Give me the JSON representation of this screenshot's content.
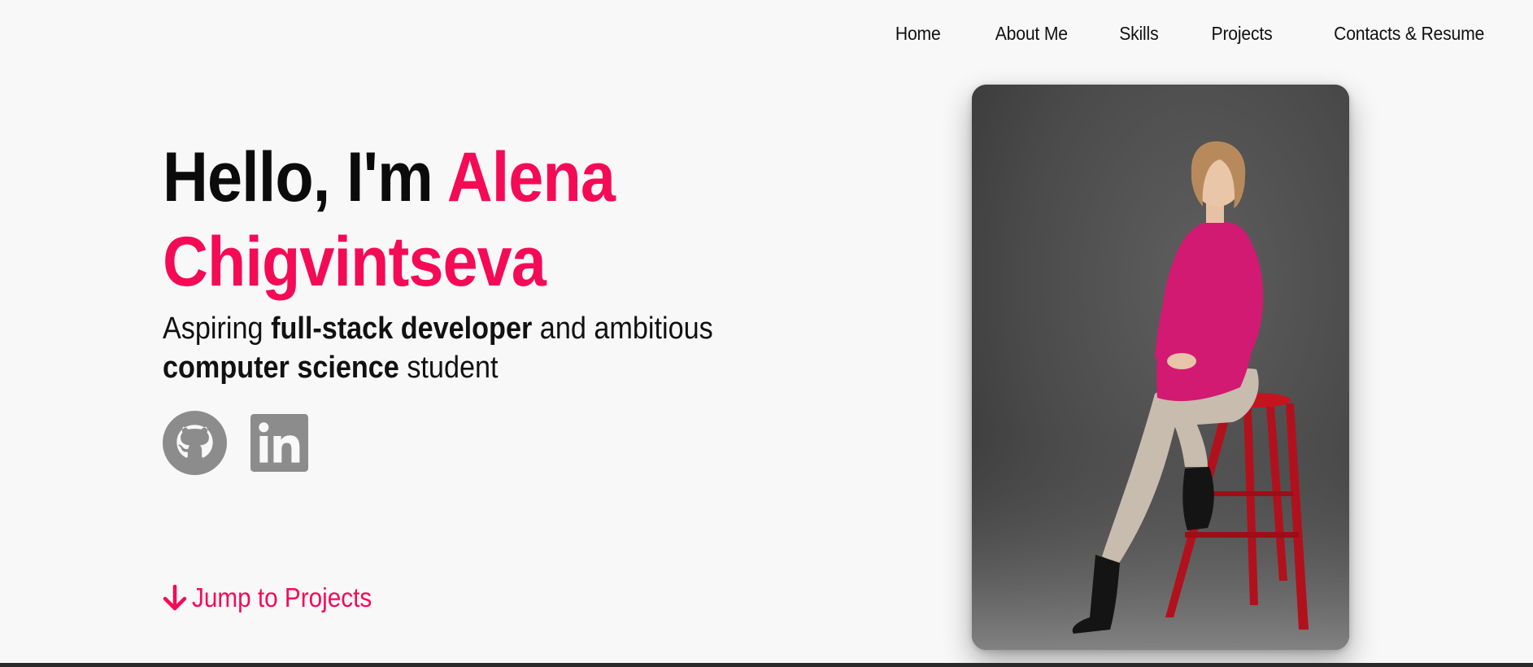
{
  "nav": {
    "items": [
      {
        "label": "Home"
      },
      {
        "label": "About Me"
      },
      {
        "label": "Skills"
      },
      {
        "label": "Projects"
      },
      {
        "label": "Contacts & Resume"
      }
    ]
  },
  "hero": {
    "greeting": "Hello, I'm",
    "name": "Alena Chigvintseva",
    "subtitle": {
      "part1": "Aspiring",
      "bold1": "full-stack developer",
      "part2": "and ambitious",
      "bold2": "computer science",
      "part3": "student"
    }
  },
  "socials": {
    "github_icon": "github-icon",
    "linkedin_icon": "linkedin-icon",
    "icon_color": "#8c8c8c"
  },
  "jump": {
    "label": "Jump to Projects",
    "icon": "arrow-down-icon"
  },
  "colors": {
    "accent": "#f50a56",
    "background": "#f8f8f9",
    "text": "#111111"
  }
}
